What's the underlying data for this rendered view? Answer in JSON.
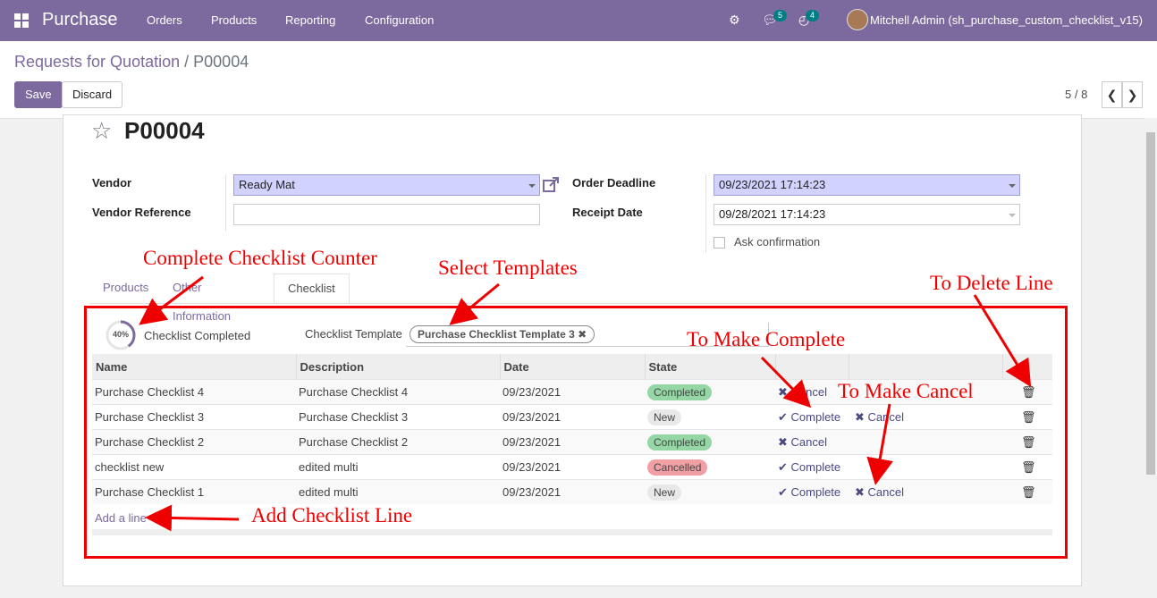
{
  "navbar": {
    "app_name": "Purchase",
    "menu": [
      "Orders",
      "Products",
      "Reporting",
      "Configuration"
    ],
    "messages_count": "5",
    "activities_count": "4",
    "user": "Mitchell Admin (sh_purchase_custom_checklist_v15)"
  },
  "breadcrumb": {
    "parent": "Requests for Quotation",
    "sep": "/",
    "current": "P00004"
  },
  "buttons": {
    "save": "Save",
    "discard": "Discard"
  },
  "pager": {
    "text": "5 / 8"
  },
  "record": {
    "title": "P00004"
  },
  "form": {
    "vendor_label": "Vendor",
    "vendor_value": "Ready Mat",
    "vendor_ref_label": "Vendor Reference",
    "vendor_ref_value": "",
    "deadline_label": "Order Deadline",
    "deadline_value": "09/23/2021 17:14:23",
    "receipt_label": "Receipt Date",
    "receipt_value": "09/28/2021 17:14:23",
    "ask_confirmation": "Ask confirmation"
  },
  "tabs": [
    "Products",
    "Other Information",
    "Checklist"
  ],
  "checklist": {
    "progress_percent": 40,
    "progress_text": "40%",
    "completed_label": "Checklist Completed",
    "template_label": "Checklist Template",
    "template_tag": "Purchase Checklist Template 3 ✖",
    "columns": [
      "Name",
      "Description",
      "Date",
      "State"
    ],
    "rows": [
      {
        "name": "Purchase Checklist 4",
        "description": "Purchase Checklist 4",
        "date": "09/23/2021",
        "state": "Completed"
      },
      {
        "name": "Purchase Checklist 3",
        "description": "Purchase Checklist 3",
        "date": "09/23/2021",
        "state": "New"
      },
      {
        "name": "Purchase Checklist 2",
        "description": "Purchase Checklist 2",
        "date": "09/23/2021",
        "state": "Completed"
      },
      {
        "name": "checklist new",
        "description": "edited multi",
        "date": "09/23/2021",
        "state": "Cancelled"
      },
      {
        "name": "Purchase Checklist 1",
        "description": "edited multi",
        "date": "09/23/2021",
        "state": "New"
      }
    ],
    "complete_label": "Complete",
    "cancel_label": "Cancel",
    "add_line": "Add a line"
  },
  "annotations": {
    "counter": "Complete Checklist Counter",
    "templates": "Select Templates",
    "delete": "To Delete Line",
    "complete": "To Make Complete",
    "cancel": "To Make Cancel",
    "add": "Add Checklist Line"
  },
  "colors": {
    "brand": "#7c6a9e",
    "annotation": "#e00000",
    "state_completed": "#94d7a5",
    "state_new": "#e8e8e8",
    "state_cancelled": "#f0a0a5"
  }
}
